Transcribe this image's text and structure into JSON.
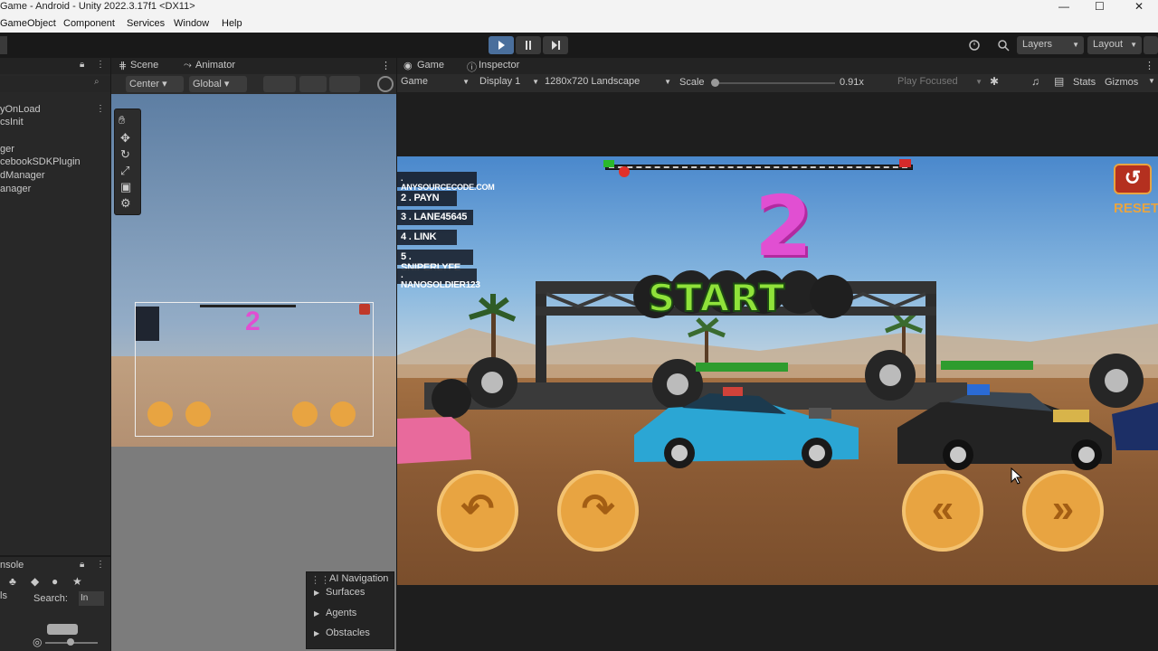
{
  "window": {
    "title": "Game - Android - Unity 2022.3.17f1 <DX11>",
    "min": "—",
    "max": "☐",
    "close": "✕"
  },
  "menu": [
    "GameObject",
    "Component",
    "Services",
    "Window",
    "Help"
  ],
  "toolbar": {
    "layers": "Layers",
    "layout": "Layout"
  },
  "hierarchy": {
    "items": [
      "yOnLoad",
      "csInit",
      "ger",
      "cebookSDKPlugin",
      "dManager",
      "anager"
    ]
  },
  "console": {
    "tab": "nsole",
    "search_label": "Search:",
    "search_value": "In",
    "left_label": "ls"
  },
  "scene": {
    "tabs": [
      "Scene",
      "Animator"
    ],
    "pivot": "Center",
    "space": "Global",
    "mini_number": "2"
  },
  "ai_nav": {
    "title": "AI Navigation",
    "items": [
      "Surfaces",
      "Agents",
      "Obstacles"
    ]
  },
  "game": {
    "tabs": [
      "Game",
      "Inspector"
    ],
    "mode": "Game",
    "display": "Display 1",
    "resolution": "1280x720 Landscape",
    "scale_label": "Scale",
    "scale_value": "0.91x",
    "play_focused": "Play Focused",
    "stats": "Stats",
    "gizmos": "Gizmos",
    "leaderboard": [
      ". ANYSOURCECODE.COM",
      "2 . PAYN",
      "3 . LANE45645",
      "4 . LINK",
      "5 . SNIPERLYFE",
      ". NANOSOLDIER123"
    ],
    "countdown": "2",
    "start_text": "START",
    "reset": "RESET",
    "progress": 0.05
  },
  "colors": {
    "accent": "#e8a441",
    "countdown": "#e14fd2",
    "start": "#8fe23a",
    "reset": "#e8a441"
  }
}
